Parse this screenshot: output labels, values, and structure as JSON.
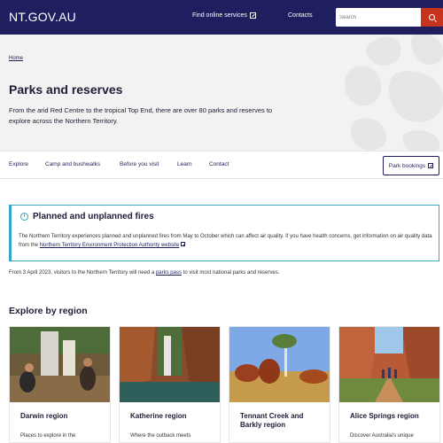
{
  "header": {
    "logo": "NT.GOV.AU",
    "find_online_services": "Find online services",
    "contacts": "Contacts",
    "search_placeholder": "Search"
  },
  "breadcrumb": {
    "home": "Home"
  },
  "page": {
    "title": "Parks and reserves",
    "intro": "From the arid Red Centre to the tropical Top End, there are over 80 parks and reserves to explore across the Northern Territory."
  },
  "subnav": {
    "items": [
      "Explore",
      "Camp and bushwalks",
      "Before you visit",
      "Learn",
      "Contact"
    ],
    "park_bookings": "Park bookings"
  },
  "alert": {
    "title": "Planned and unplanned fires",
    "body": "The Northern Territory experiences planned and unplanned fires from May to October which can affect air quality. If you have health concerns, get information on air quality data from the",
    "link": "Northern Territory Environment Protection Authority website"
  },
  "pass_note": {
    "before": "From 3 April 2023, visitors to the Northern Territory will need a",
    "link": "parks pass",
    "after": "to visit most national parks and reserves."
  },
  "regions": {
    "heading": "Explore by region",
    "cards": [
      {
        "title": "Darwin region",
        "desc": "Places to explore in the"
      },
      {
        "title": "Katherine region",
        "desc": "Where the outback meets"
      },
      {
        "title": "Tennant Creek and Barkly region",
        "desc": ""
      },
      {
        "title": "Alice Springs region",
        "desc": "Discover Australia's unique"
      }
    ]
  },
  "colors": {
    "navy": "#1f1f5f",
    "search_red": "#c8331f",
    "alert_teal": "#36a7c5",
    "hero_grey": "#f2f2f2"
  },
  "icons": [
    "external-link-icon",
    "search-icon",
    "info-icon"
  ]
}
